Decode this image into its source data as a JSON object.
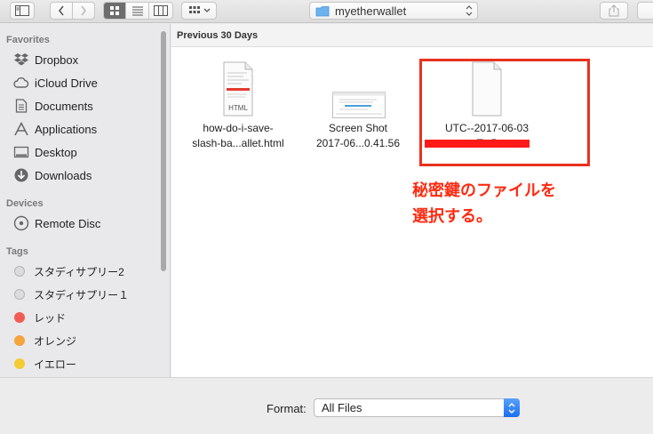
{
  "toolbar": {
    "path_folder": "myetherwallet"
  },
  "sidebar": {
    "favorites_heading": "Favorites",
    "favorites": [
      {
        "label": "Dropbox",
        "icon": "dropbox-icon"
      },
      {
        "label": "iCloud Drive",
        "icon": "cloud-icon"
      },
      {
        "label": "Documents",
        "icon": "documents-icon"
      },
      {
        "label": "Applications",
        "icon": "applications-icon"
      },
      {
        "label": "Desktop",
        "icon": "desktop-icon"
      },
      {
        "label": "Downloads",
        "icon": "downloads-icon"
      }
    ],
    "devices_heading": "Devices",
    "devices": [
      {
        "label": "Remote Disc",
        "icon": "disc-icon"
      }
    ],
    "tags_heading": "Tags",
    "tags": [
      {
        "label": "スタディサプリー2",
        "color": "#d0d0d0"
      },
      {
        "label": "スタディサプリー１",
        "color": "#d0d0d0"
      },
      {
        "label": "レッド",
        "color": "#f25c55"
      },
      {
        "label": "オレンジ",
        "color": "#f5a33c"
      },
      {
        "label": "イエロー",
        "color": "#f4cc33"
      }
    ]
  },
  "main": {
    "section_title": "Previous 30 Days",
    "files": [
      {
        "line1": "how-do-i-save-",
        "line2": "slash-ba...allet.html",
        "badge": "HTML"
      },
      {
        "line1": "Screen Shot",
        "line2": "2017-06...0.41.56"
      },
      {
        "line1": "UTC--2017-06-03",
        "line2": "T...5"
      }
    ],
    "annotation_line1": "秘密鍵のファイルを",
    "annotation_line2": "選択する。",
    "accent_color": "#e8321e"
  },
  "bottom": {
    "format_label": "Format:",
    "format_value": "All Files"
  }
}
